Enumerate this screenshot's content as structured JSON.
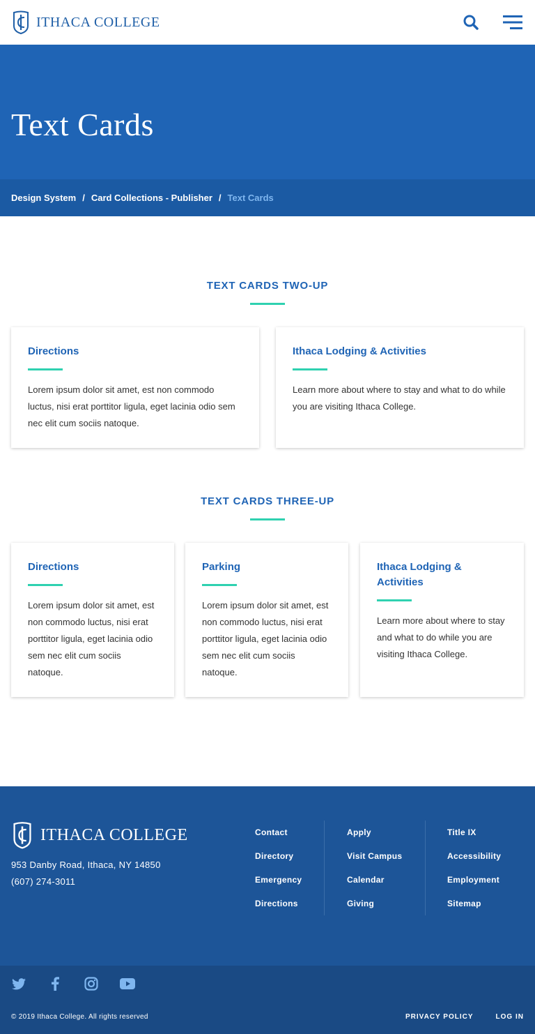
{
  "header": {
    "logo_text": "ITHACA COLLEGE",
    "search_icon": "search-icon",
    "menu_icon": "hamburger-menu-icon"
  },
  "hero": {
    "title": "Text Cards"
  },
  "breadcrumb": {
    "items": [
      "Design System",
      "Card Collections - Publisher"
    ],
    "current": "Text Cards",
    "separator": "/"
  },
  "two_up": {
    "title": "TEXT CARDS TWO-UP",
    "cards": [
      {
        "heading": "Directions",
        "body": "Lorem ipsum dolor sit amet, est non commodo luctus, nisi erat porttitor ligula, eget lacinia odio sem nec elit cum sociis natoque."
      },
      {
        "heading": "Ithaca Lodging & Activities",
        "body": "Learn more about where to stay and what to do while you are visiting Ithaca College."
      }
    ]
  },
  "three_up": {
    "title": "TEXT CARDS THREE-UP",
    "cards": [
      {
        "heading": "Directions",
        "body": "Lorem ipsum dolor sit amet, est non commodo luctus, nisi erat porttitor ligula, eget lacinia odio sem nec elit cum sociis natoque."
      },
      {
        "heading": "Parking",
        "body": "Lorem ipsum dolor sit amet, est non commodo luctus, nisi erat porttitor ligula, eget lacinia odio sem nec elit cum sociis natoque."
      },
      {
        "heading": "Ithaca Lodging & Activities",
        "body": "Learn more about where to stay and what to do while you are visiting Ithaca College."
      }
    ]
  },
  "footer": {
    "logo_text": "ITHACA COLLEGE",
    "address_line1": "953 Danby Road, Ithaca, NY 14850",
    "phone": "(607) 274-3011",
    "col1": [
      "Contact",
      "Directory",
      "Emergency",
      "Directions"
    ],
    "col2": [
      "Apply",
      "Visit Campus",
      "Calendar",
      "Giving"
    ],
    "col3": [
      "Title IX",
      "Accessibility",
      "Employment",
      "Sitemap"
    ]
  },
  "bottom": {
    "social": [
      "twitter-icon",
      "facebook-icon",
      "instagram-icon",
      "youtube-icon"
    ],
    "copyright": "© 2019 Ithaca College. All rights reserved",
    "privacy": "PRIVACY POLICY",
    "login": "LOG IN"
  },
  "colors": {
    "brand_blue": "#1f64b5",
    "accent_teal": "#2fd1b0",
    "footer_blue": "#1d5598"
  }
}
